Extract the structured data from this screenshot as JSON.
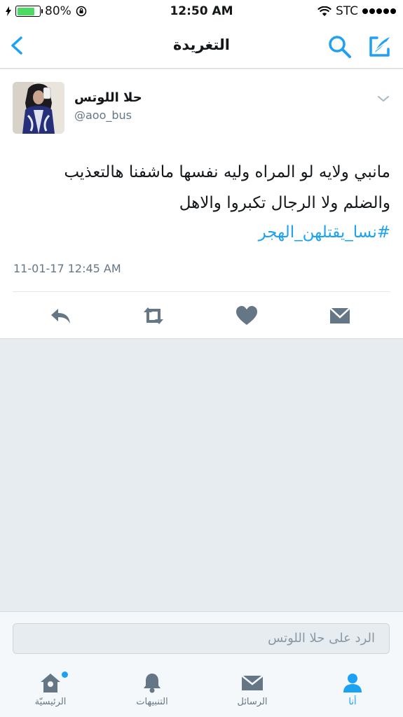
{
  "status_bar": {
    "battery": "80%",
    "time": "12:50 AM",
    "carrier": "STC"
  },
  "nav": {
    "title": "التغريدة"
  },
  "tweet": {
    "author_name": "حلا اللوتس",
    "handle": "@aoo_bus",
    "text_line1": "مانبي ولايه لو المراه وليه نفسها ماشفنا هالتعذيب",
    "text_line2": "والضلم ولا الرجال تكبروا والاهل",
    "hashtag": "#نسا_يقتلهن_الهجر",
    "timestamp": "11-01-17 12:45 AM",
    "battery_level": 0.8
  },
  "reply": {
    "placeholder": "الرد على حلا اللوتس"
  },
  "tabs": [
    {
      "label": "الرئيسيّة",
      "icon": "home-icon"
    },
    {
      "label": "التنبيهات",
      "icon": "bell-icon"
    },
    {
      "label": "الرسائل",
      "icon": "envelope-icon"
    },
    {
      "label": "أنا",
      "icon": "person-icon"
    }
  ],
  "colors": {
    "accent": "#1da1f2",
    "icon_gray": "#657786"
  }
}
